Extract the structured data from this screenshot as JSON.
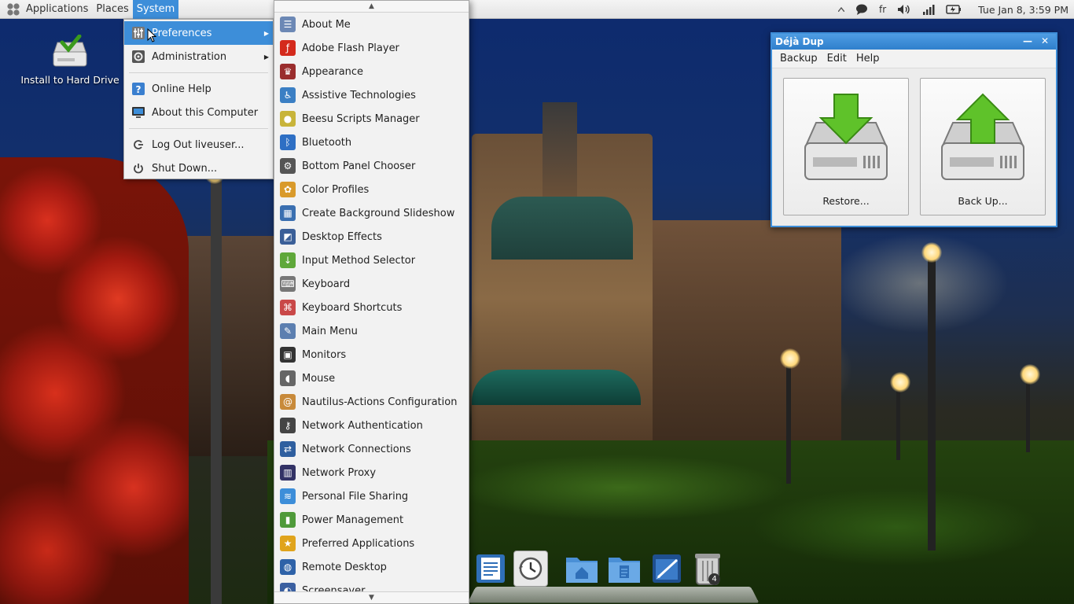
{
  "top_panel": {
    "menus": [
      "Applications",
      "Places",
      "System"
    ],
    "active_menu": "System",
    "tray": {
      "keyboard_layout": "fr",
      "clock": "Tue Jan  8,  3:59 PM"
    },
    "icons": [
      "distributor-logo-icon",
      "chevron-up-icon",
      "chat-icon",
      "volume-icon",
      "signal-icon",
      "battery-icon"
    ]
  },
  "desktop": {
    "icons": [
      {
        "label": "Install to Hard Drive",
        "icon": "install-drive-icon"
      }
    ]
  },
  "system_menu": {
    "items": [
      {
        "label": "Preferences",
        "icon": "preferences-icon",
        "submenu": true,
        "highlighted": true
      },
      {
        "label": "Administration",
        "icon": "administration-icon",
        "submenu": true
      },
      {
        "label": "Online Help",
        "icon": "help-icon"
      },
      {
        "label": "About this Computer",
        "icon": "computer-icon"
      },
      {
        "label": "Log Out liveuser...",
        "icon": "logout-icon"
      },
      {
        "label": "Shut Down...",
        "icon": "power-icon"
      }
    ]
  },
  "preferences_menu": {
    "items": [
      {
        "label": "About Me",
        "icon": "about-me-icon",
        "color": "#6c88b5",
        "glyph": "☰"
      },
      {
        "label": "Adobe Flash Player",
        "icon": "flash-icon",
        "color": "#d42a1c",
        "glyph": "ƒ"
      },
      {
        "label": "Appearance",
        "icon": "appearance-icon",
        "color": "#9a2d2d",
        "glyph": "♛"
      },
      {
        "label": "Assistive Technologies",
        "icon": "accessibility-icon",
        "color": "#3b7fc4",
        "glyph": "♿"
      },
      {
        "label": "Beesu Scripts Manager",
        "icon": "beesu-icon",
        "color": "#c8b43a",
        "glyph": "●"
      },
      {
        "label": "Bluetooth",
        "icon": "bluetooth-icon",
        "color": "#2e6fc4",
        "glyph": "ᛒ"
      },
      {
        "label": "Bottom Panel Chooser",
        "icon": "panel-chooser-icon",
        "color": "#555555",
        "glyph": "⚙"
      },
      {
        "label": "Color Profiles",
        "icon": "color-profiles-icon",
        "color": "#d99a2b",
        "glyph": "✿"
      },
      {
        "label": "Create Background Slideshow",
        "icon": "slideshow-icon",
        "color": "#3a6fb0",
        "glyph": "▦"
      },
      {
        "label": "Desktop Effects",
        "icon": "desktop-effects-icon",
        "color": "#3b5f98",
        "glyph": "◩"
      },
      {
        "label": "Input Method Selector",
        "icon": "input-method-icon",
        "color": "#5fa83a",
        "glyph": "↓"
      },
      {
        "label": "Keyboard",
        "icon": "keyboard-icon",
        "color": "#777777",
        "glyph": "⌨"
      },
      {
        "label": "Keyboard Shortcuts",
        "icon": "keyboard-shortcuts-icon",
        "color": "#c94848",
        "glyph": "⌘"
      },
      {
        "label": "Main Menu",
        "icon": "main-menu-icon",
        "color": "#5c7fb0",
        "glyph": "✎"
      },
      {
        "label": "Monitors",
        "icon": "monitors-icon",
        "color": "#333333",
        "glyph": "▣"
      },
      {
        "label": "Mouse",
        "icon": "mouse-icon",
        "color": "#666666",
        "glyph": "◖"
      },
      {
        "label": "Nautilus-Actions Configuration",
        "icon": "nautilus-actions-icon",
        "color": "#c88a3a",
        "glyph": "@"
      },
      {
        "label": "Network Authentication",
        "icon": "network-auth-icon",
        "color": "#444444",
        "glyph": "⚷"
      },
      {
        "label": "Network Connections",
        "icon": "network-connections-icon",
        "color": "#2f5f9f",
        "glyph": "⇄"
      },
      {
        "label": "Network Proxy",
        "icon": "network-proxy-icon",
        "color": "#333366",
        "glyph": "▥"
      },
      {
        "label": "Personal File Sharing",
        "icon": "file-sharing-icon",
        "color": "#3d8ed9",
        "glyph": "≋"
      },
      {
        "label": "Power Management",
        "icon": "power-management-icon",
        "color": "#4f9a3a",
        "glyph": "▮"
      },
      {
        "label": "Preferred Applications",
        "icon": "preferred-apps-icon",
        "color": "#e0a41c",
        "glyph": "★"
      },
      {
        "label": "Remote Desktop",
        "icon": "remote-desktop-icon",
        "color": "#2e62a8",
        "glyph": "◍"
      },
      {
        "label": "Screensaver",
        "icon": "screensaver-icon",
        "color": "#3a5fa0",
        "glyph": "◐"
      }
    ]
  },
  "deja_dup": {
    "title": "Déjà Dup",
    "menus": [
      "Backup",
      "Edit",
      "Help"
    ],
    "buttons": [
      {
        "label": "Restore...",
        "icon": "restore-icon"
      },
      {
        "label": "Back Up...",
        "icon": "backup-icon"
      }
    ],
    "window_controls": {
      "minimize": "—",
      "close": "✕"
    }
  },
  "dock": {
    "items": [
      {
        "icon": "document-viewer-icon"
      },
      {
        "icon": "time-machine-icon"
      },
      {
        "icon": "home-folder-icon"
      },
      {
        "icon": "documents-folder-icon"
      },
      {
        "icon": "text-editor-icon"
      },
      {
        "icon": "trash-icon",
        "badge": "4"
      }
    ]
  },
  "colors": {
    "accent": "#3d8ed9",
    "menu_bg": "#f2f2f2"
  }
}
